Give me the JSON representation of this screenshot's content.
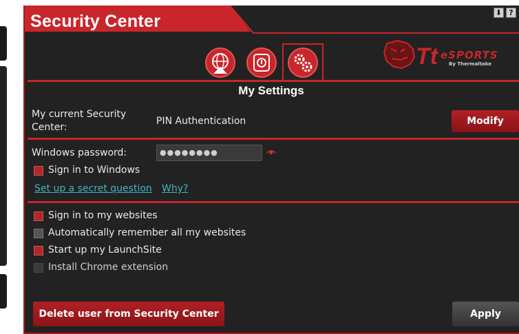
{
  "window": {
    "title": "Security Center",
    "controls": [
      "download-icon",
      "help-icon"
    ]
  },
  "tabs": [
    {
      "name": "globe-upload-icon",
      "active": false
    },
    {
      "name": "security-shield-icon",
      "active": false
    },
    {
      "name": "settings-gears-icon",
      "active": true
    }
  ],
  "brand": {
    "logo": "tt-esports-logo",
    "text": "eSPORTS",
    "subtext": "By Thermaltake"
  },
  "page": {
    "section_title": "My Settings"
  },
  "security_center": {
    "label": "My current Security Center:",
    "value": "PIN Authentication",
    "modify_button": "Modify"
  },
  "windows_password": {
    "label": "Windows password:",
    "masked_value": "●●●●●●●●",
    "reveal_icon": "eye-icon"
  },
  "sign_in_windows": {
    "label": "Sign in to Windows",
    "checked": true
  },
  "links": {
    "secret_question": "Set up a secret question",
    "why": "Why?"
  },
  "options": [
    {
      "label": "Sign in to my websites",
      "checked": true
    },
    {
      "label": "Automatically remember all my websites",
      "checked": false
    },
    {
      "label": "Start up my LaunchSite",
      "checked": true
    },
    {
      "label": "Install Chrome extension",
      "checked": false,
      "disabled": true
    }
  ],
  "footer": {
    "delete_button": "Delete user from Security Center",
    "apply_button": "Apply"
  },
  "colors": {
    "accent": "#c8262b",
    "background": "#222222",
    "link": "#3fb6c2"
  }
}
